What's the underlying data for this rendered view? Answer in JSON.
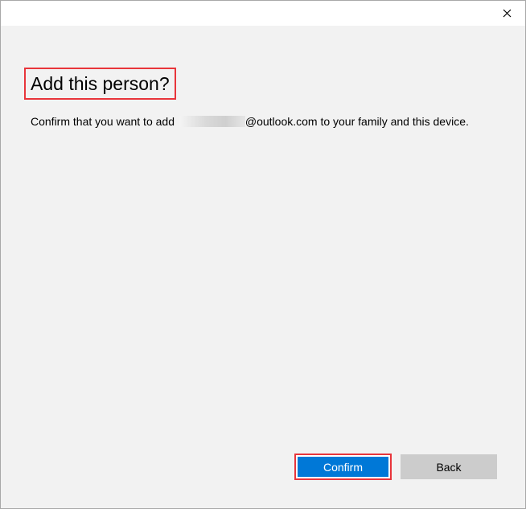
{
  "window": {
    "close_symbol": "✕"
  },
  "dialog": {
    "title": "Add this person?",
    "message_prefix": "Confirm that you want to add ",
    "message_suffix": "@outlook.com to your family and this device."
  },
  "buttons": {
    "confirm_label": "Confirm",
    "back_label": "Back"
  },
  "colors": {
    "accent": "#0078d7",
    "highlight": "#e8353b",
    "background": "#f2f2f2"
  },
  "icons": {
    "close": "close-icon"
  }
}
